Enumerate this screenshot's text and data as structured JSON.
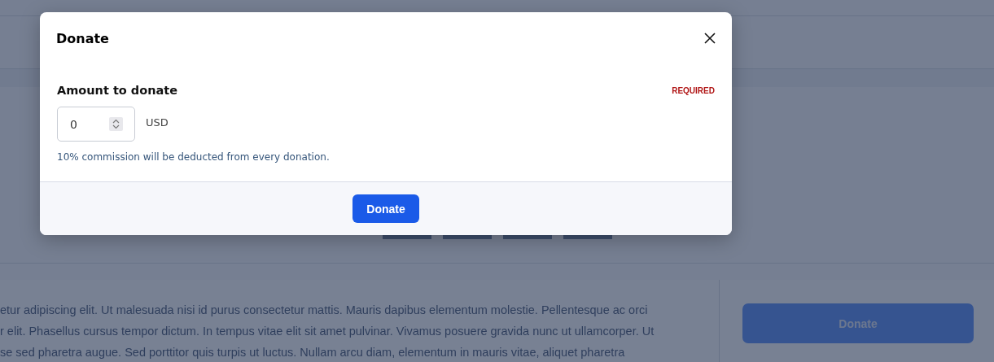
{
  "page": {
    "paragraph_lines": [
      "etur adipiscing elit. Ut malesuada nisi id purus consectetur mattis. Mauris dapibus elementum molestie. Pellentesque ac orci",
      "r elit. Phasellus cursus tempor dictum. In tempus vitae elit sit amet pulvinar. Vivamus posuere gravida nunc ut ullamcorper. Ut",
      "se sed pharetra augue. Sed porttitor quis turpis ut luctus. Nullam arcu diam, elementum in mauris vitae, aliquet pharetra"
    ],
    "side_button": "Donate"
  },
  "modal": {
    "title": "Donate",
    "field_label": "Amount to donate",
    "required": "REQUIRED",
    "amount": "0",
    "currency": "USD",
    "hint": "10% commission will be deducted from every donation.",
    "submit": "Donate"
  }
}
